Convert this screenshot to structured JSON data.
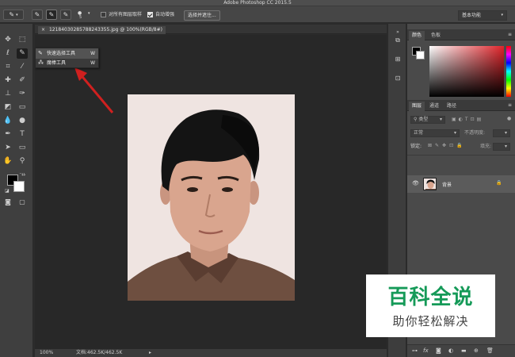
{
  "app": {
    "title": "Adobe Photoshop CC 2015.5"
  },
  "options_bar": {
    "brush_size": "5",
    "sample_all_layers_label": "对所有图层取样",
    "auto_enhance_label": "自动增强",
    "select_and_mask_label": "选择并遮住...",
    "workspace": "基本功能",
    "sample_all_layers_checked": false,
    "auto_enhance_checked": true
  },
  "document": {
    "tab_label": "12184030285788243355.jpg @ 100%(RGB/8#)",
    "zoom": "100%",
    "doc_size": "文档:462.5K/462.5K"
  },
  "flyout": {
    "items": [
      {
        "label": "快速选择工具",
        "key": "W"
      },
      {
        "label": "魔棒工具",
        "key": "W"
      }
    ]
  },
  "panels": {
    "color": {
      "tabs": [
        "颜色",
        "色板"
      ]
    },
    "layers": {
      "tabs": [
        "图层",
        "通道",
        "路径"
      ],
      "filter_label": "类型",
      "blend_mode": "正常",
      "opacity_label": "不透明度:",
      "lock_label": "锁定:",
      "fill_label": "填充:",
      "layer_name": "背景"
    }
  },
  "watermark": {
    "title": "百科全说",
    "subtitle": "助你轻松解决"
  },
  "colors": {
    "watermark_green": "#159a58",
    "annotation_red": "#d0201f"
  }
}
